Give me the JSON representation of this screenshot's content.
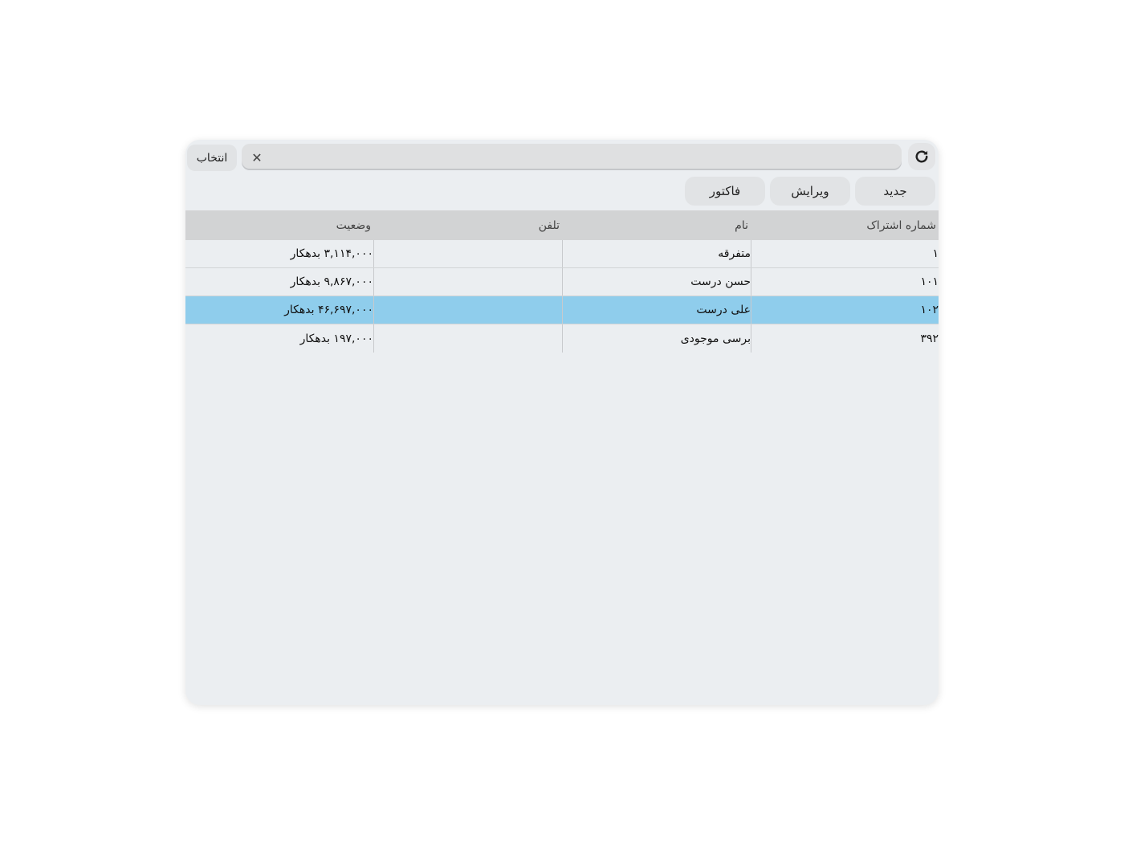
{
  "toolbar": {
    "select_label": "انتخاب",
    "search_placeholder": "",
    "clear_glyph": "✕",
    "refresh_icon": "refresh-icon"
  },
  "actions": {
    "new_label": "جدید",
    "edit_label": "ویرایش",
    "invoice_label": "فاکتور"
  },
  "table": {
    "headers": [
      "شماره اشتراک",
      "نام",
      "تلفن",
      "وضعیت"
    ],
    "rows": [
      {
        "id": "۱",
        "name": "متفرقه",
        "phone": "",
        "status": "۳,۱۱۴,۰۰۰ بدهکار",
        "selected": false
      },
      {
        "id": "۱۰۱",
        "name": "حسن درست",
        "phone": "",
        "status": "۹,۸۶۷,۰۰۰ بدهکار",
        "selected": false
      },
      {
        "id": "۱۰۲",
        "name": "علی درست",
        "phone": "",
        "status": "۴۶,۶۹۷,۰۰۰ بدهکار",
        "selected": true
      },
      {
        "id": "۳۹۲",
        "name": "برسی موجودی",
        "phone": "",
        "status": "۱۹۷,۰۰۰ بدهکار",
        "selected": false
      }
    ]
  },
  "colors": {
    "window_bg": "#ebeef1",
    "header_bg": "#d2d3d4",
    "selected_row": "#8fcdec"
  }
}
